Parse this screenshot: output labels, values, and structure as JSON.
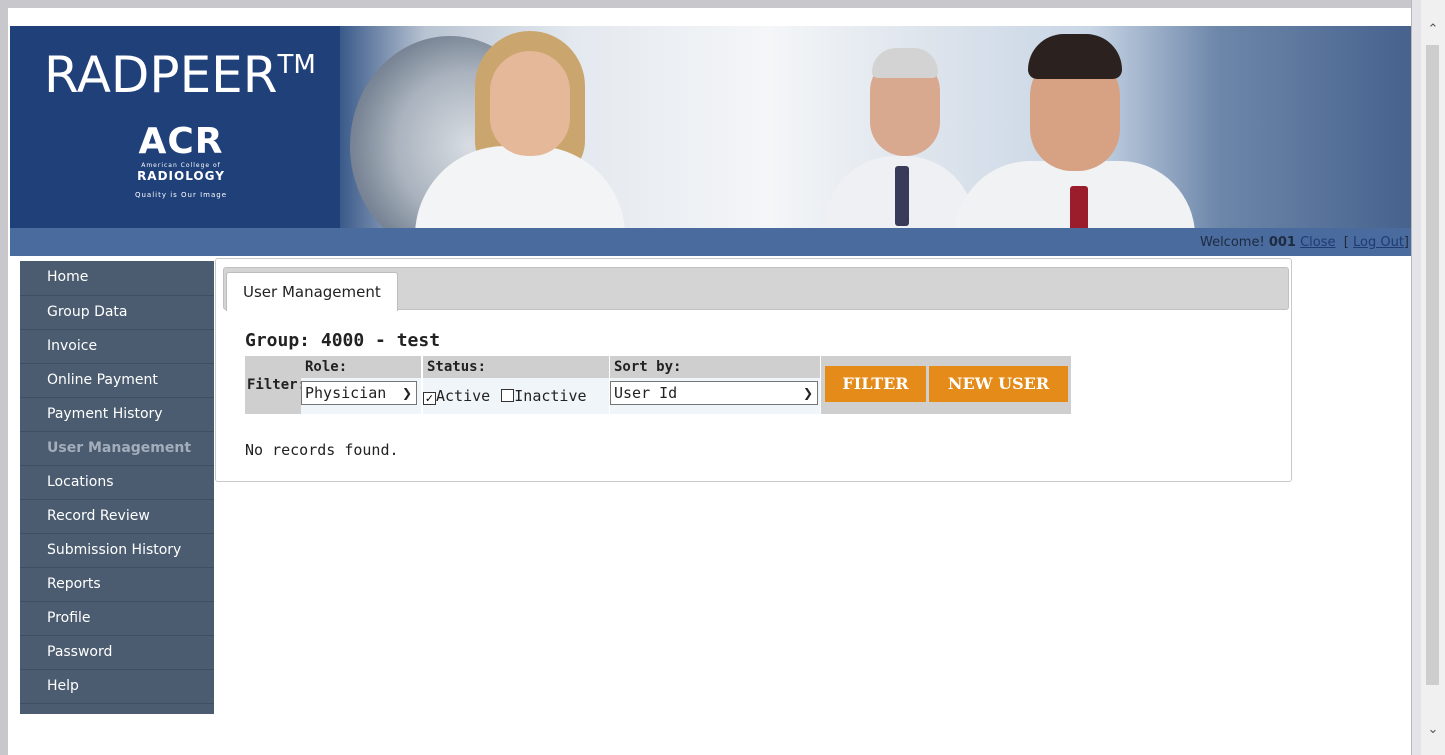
{
  "header": {
    "app_name": "RADPEER",
    "trademark": "TM",
    "logo_text": "ACR",
    "logo_org_line1": "American College of",
    "logo_org_line2": "RADIOLOGY",
    "logo_tagline": "Quality is Our Image"
  },
  "welcome": {
    "greeting": "Welcome!",
    "user": "001",
    "close_link": "Close",
    "logout_prefix": "[",
    "logout_link": "Log Out",
    "logout_suffix": "]"
  },
  "sidebar": {
    "items": [
      {
        "label": "Home"
      },
      {
        "label": "Group Data"
      },
      {
        "label": "Invoice"
      },
      {
        "label": "Online Payment"
      },
      {
        "label": "Payment History"
      },
      {
        "label": "User Management"
      },
      {
        "label": "Locations"
      },
      {
        "label": "Record Review"
      },
      {
        "label": "Submission History"
      },
      {
        "label": "Reports"
      },
      {
        "label": "Profile"
      },
      {
        "label": "Password"
      },
      {
        "label": "Help"
      }
    ],
    "active_index": 5
  },
  "main": {
    "tab_label": "User Management",
    "group_title": "Group: 4000 - test",
    "filter": {
      "label": "Filter:",
      "role_header": "Role:",
      "role_value": "Physician",
      "status_header": "Status:",
      "active_label": "Active",
      "active_checked": true,
      "inactive_label": "Inactive",
      "inactive_checked": false,
      "sort_header": "Sort by:",
      "sort_value": "User Id"
    },
    "buttons": {
      "filter": "FILTER",
      "new_user": "NEW USER"
    },
    "empty_message": "No records found."
  },
  "colors": {
    "header_blue": "#1e3b72",
    "sidebar": "#4b5c70",
    "button_orange": "#e48b19"
  }
}
